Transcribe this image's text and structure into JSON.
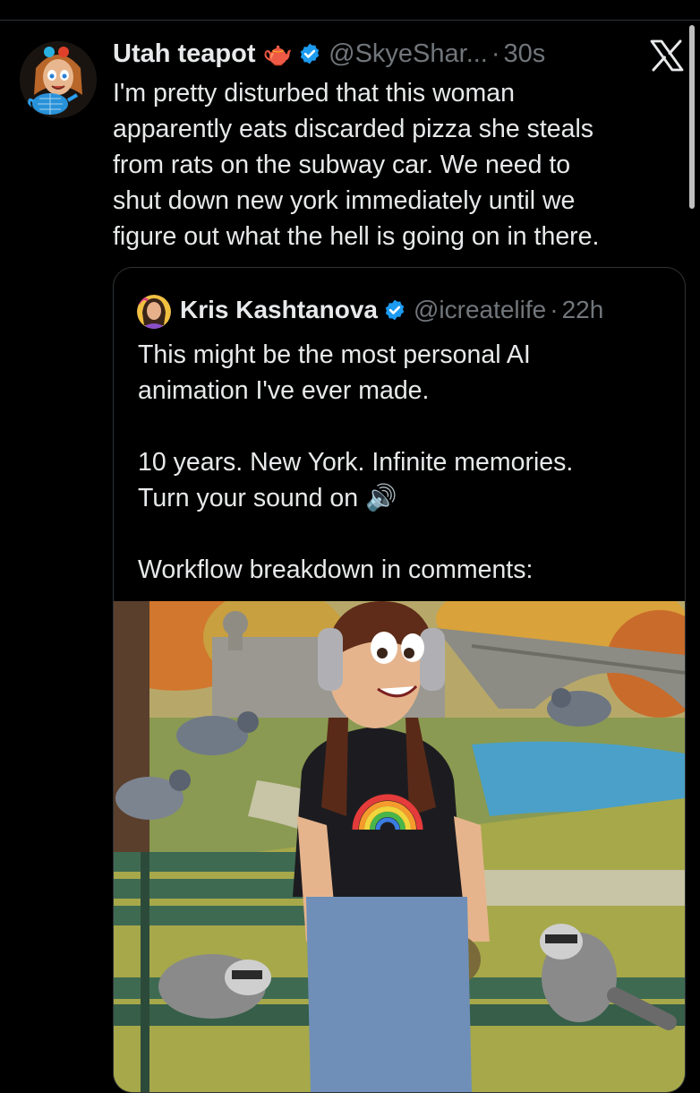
{
  "tweet": {
    "author_name": "Utah teapot",
    "name_emoji": "🫖",
    "handle": "@SkyeShar...",
    "separator": "·",
    "time": "30s",
    "text": "I'm pretty disturbed that this woman\napparently eats discarded pizza she steals\nfrom rats on the subway car. We need to\nshut down new york immediately until we\nfigure out what the hell is going on in there.",
    "avatar_icon": "cartoon-avatar-with-teapot",
    "verified_icon": "verified-badge-icon",
    "logo_icon": "x-logo-icon"
  },
  "quote": {
    "author_name": "Kris Kashtanova",
    "handle": "@icreatelife",
    "separator": "·",
    "time": "22h",
    "text": "This might be the most personal AI\nanimation I've ever made.\n\n10 years. New York. Infinite memories.\nTurn your sound on 🔊\n\nWorkflow breakdown in comments:",
    "media_icon": "cartoon-park-scene-image"
  },
  "colors": {
    "background": "#000000",
    "text": "#e7e9ea",
    "muted": "#71767b",
    "verified": "#1d9bf0",
    "border": "#2f3336"
  }
}
